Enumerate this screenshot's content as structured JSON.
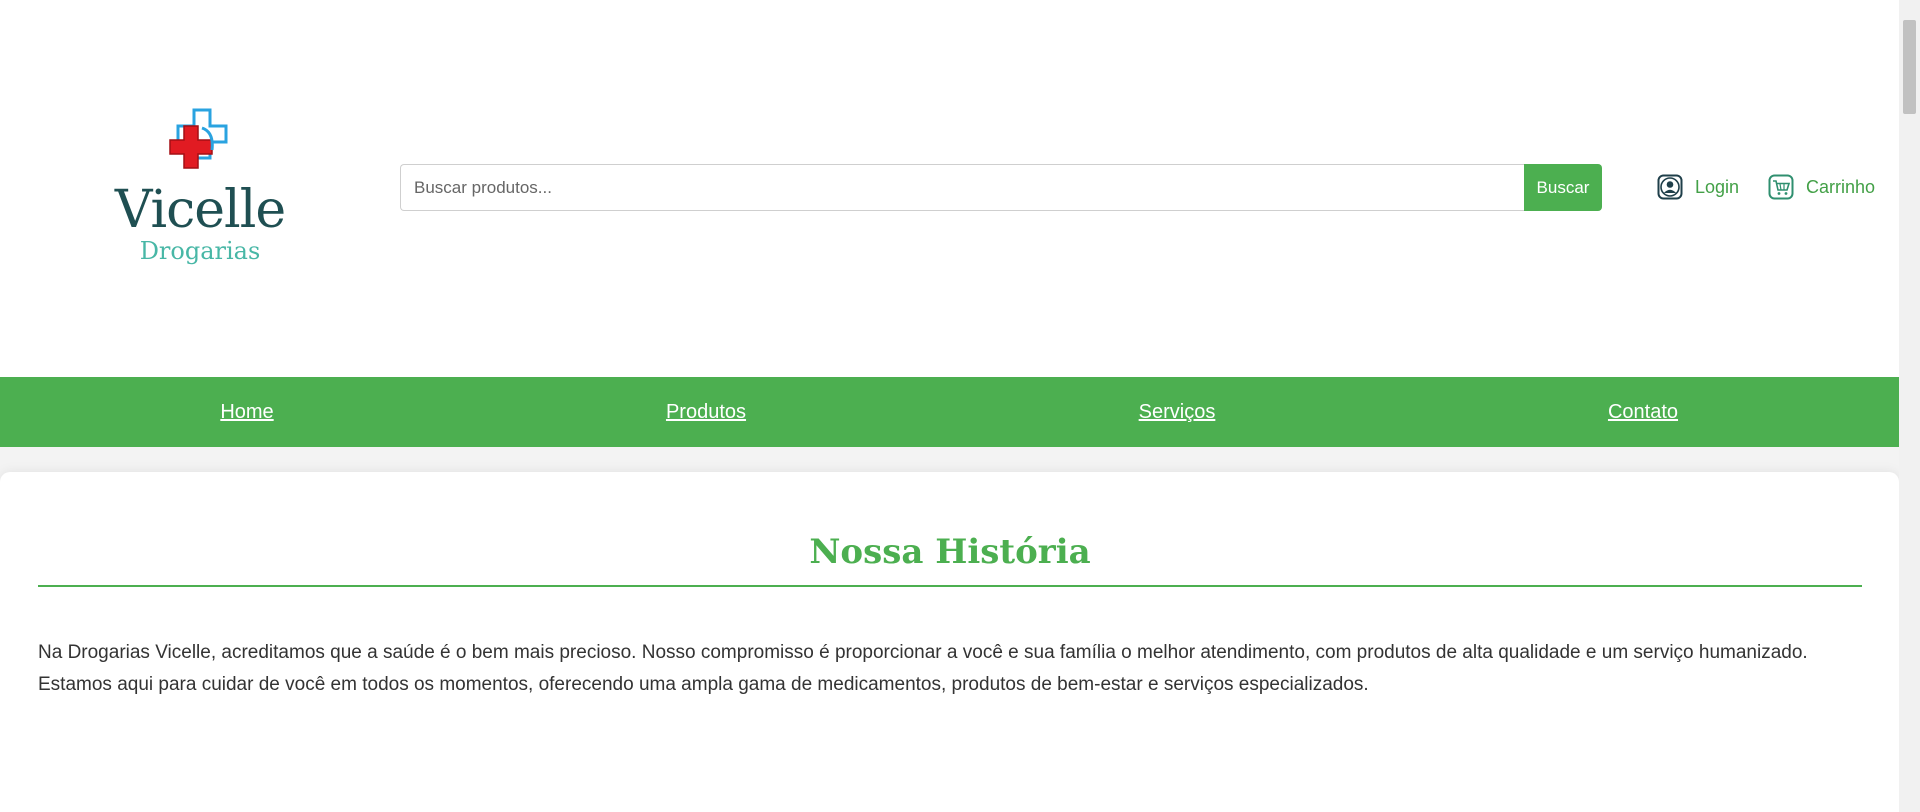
{
  "brand": {
    "name": "Vicelle",
    "subtitle": "Drogarias"
  },
  "search": {
    "placeholder": "Buscar produtos...",
    "value": "",
    "button_label": "Buscar"
  },
  "account": {
    "login_label": "Login",
    "cart_label": "Carrinho",
    "login_icon": "user-icon",
    "cart_icon": "cart-icon"
  },
  "nav": {
    "items": [
      "Home",
      "Produtos",
      "Serviços",
      "Contato"
    ]
  },
  "history": {
    "title": "Nossa História",
    "text": "Na Drogarias Vicelle, acreditamos que a saúde é o bem mais precioso. Nosso compromisso é proporcionar a você e sua família o melhor atendimento, com produtos de alta qualidade e um serviço humanizado. Estamos aqui para cuidar de você em todos os momentos, oferecendo uma ampla gama de medicamentos, produtos de bem-estar e serviços especializados."
  },
  "colors": {
    "primary_green": "#4caf50",
    "logo_dark": "#1f4f52",
    "logo_teal": "#48b7a6",
    "logo_red": "#e11b22",
    "logo_blue": "#2aa3e0"
  }
}
